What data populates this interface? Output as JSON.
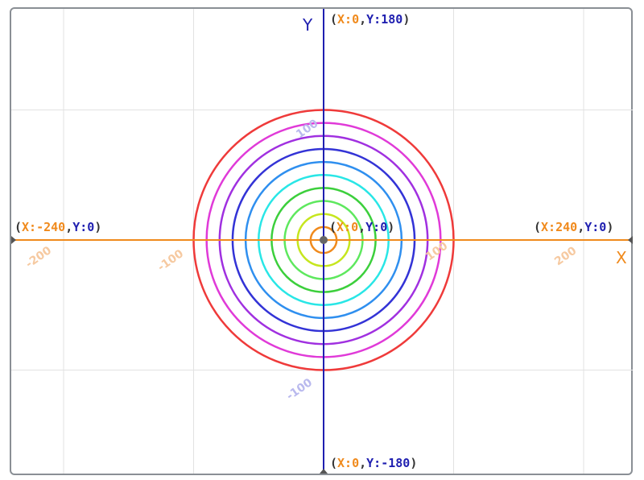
{
  "colors": {
    "x_axis": "#f08a1c",
    "y_axis": "#1f1fb0",
    "grid": "#e2e2e2",
    "frame": "#8a8f95",
    "paren_text": "#333333",
    "x_tick": "#f6c9a0",
    "y_tick": "#b9b9ee"
  },
  "axes": {
    "x_name": "X",
    "y_name": "Y"
  },
  "labels": {
    "top": {
      "open": "(",
      "x": "X:0",
      "comma": ",",
      "y": "Y:180",
      "close": ")"
    },
    "bottom": {
      "open": "(",
      "x": "X:0",
      "comma": ",",
      "y": "Y:-180",
      "close": ")"
    },
    "left": {
      "open": "(",
      "x": "X:-240",
      "comma": ",",
      "y": "Y:0",
      "close": ")"
    },
    "right": {
      "open": "(",
      "x": "X:240",
      "comma": ",",
      "y": "Y:0",
      "close": ")"
    },
    "origin": {
      "open": "(",
      "x": "X:0",
      "comma": ",",
      "y": "Y:0",
      "close": ")"
    }
  },
  "x_ticks": [
    "-200",
    "-100",
    "100",
    "200"
  ],
  "y_ticks": [
    "100",
    "-100"
  ],
  "circles": [
    {
      "radius": 10,
      "color": "#f08a1c"
    },
    {
      "radius": 20,
      "color": "#c6e61e"
    },
    {
      "radius": 30,
      "color": "#5ee85e"
    },
    {
      "radius": 40,
      "color": "#3ccf3c"
    },
    {
      "radius": 50,
      "color": "#29e6e6"
    },
    {
      "radius": 60,
      "color": "#2f8fef"
    },
    {
      "radius": 70,
      "color": "#3333d6"
    },
    {
      "radius": 80,
      "color": "#a030e0"
    },
    {
      "radius": 90,
      "color": "#e03ad8"
    },
    {
      "radius": 100,
      "color": "#ef3a3a"
    }
  ]
}
